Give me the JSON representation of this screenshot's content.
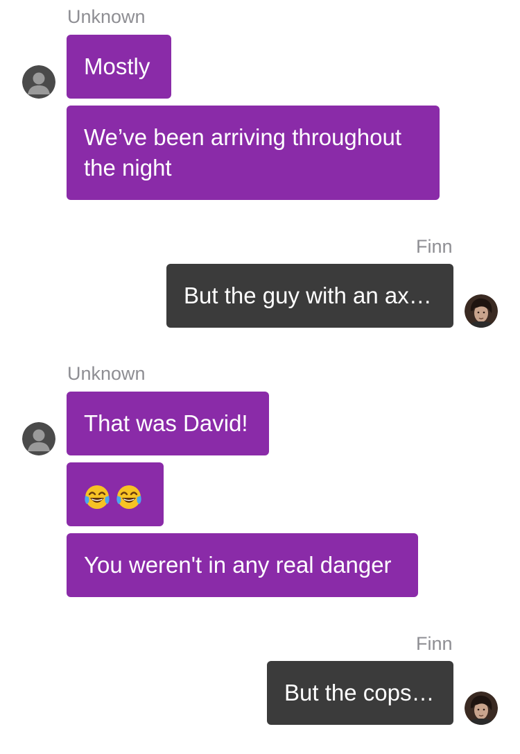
{
  "messages": [
    {
      "sender": "Unknown",
      "bubbles": [
        "Mostly",
        "We’ve been arriving throughout the night"
      ]
    },
    {
      "sender": "Finn",
      "bubbles": [
        "But the guy with an ax…"
      ]
    },
    {
      "sender": "Unknown",
      "bubbles": [
        "That was David!",
        "😂😂",
        "You weren't in any real danger"
      ]
    },
    {
      "sender": "Finn",
      "bubbles": [
        "But the cops…"
      ]
    }
  ],
  "colors": {
    "incoming_bubble": "#8a2ba8",
    "outgoing_bubble": "#3b3b3b",
    "sender_name": "#8e8e93",
    "background": "#ffffff"
  },
  "icons": {
    "unknown_avatar": "default-person-avatar-icon",
    "finn_avatar": "finn-portrait-avatar-icon",
    "emoji": "face-with-tears-of-joy-emoji"
  }
}
